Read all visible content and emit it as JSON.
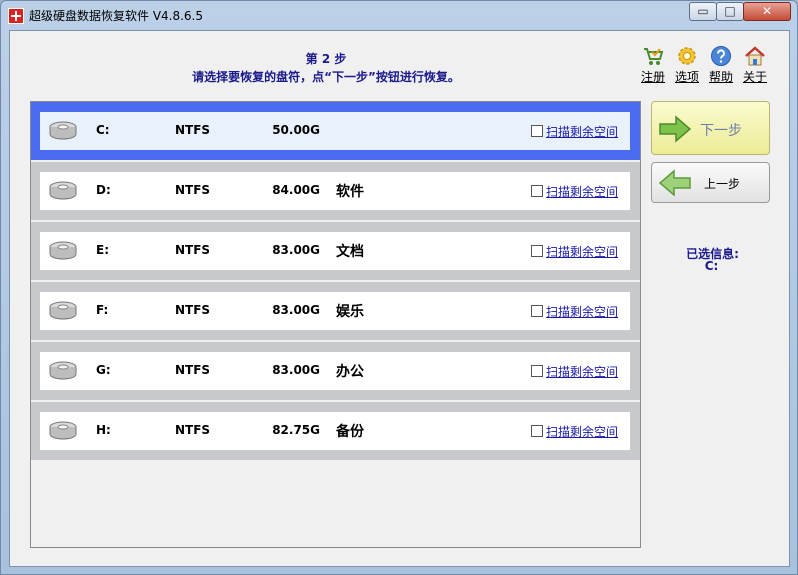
{
  "window": {
    "title": "超级硬盘数据恢复软件 V4.8.6.5",
    "minimize_symbol": "▭",
    "maximize_symbol": "□",
    "close_symbol": "✕"
  },
  "header": {
    "step": "第 2 步",
    "instruction": "请选择要恢复的盘符，点“下一步”按钮进行恢复。"
  },
  "toolbar": {
    "items": [
      {
        "label": "注册",
        "icon": "cart-icon"
      },
      {
        "label": "选项",
        "icon": "gear-icon"
      },
      {
        "label": "帮助",
        "icon": "help-icon"
      },
      {
        "label": "关于",
        "icon": "home-icon"
      }
    ]
  },
  "drives": [
    {
      "letter": "C:",
      "fs": "NTFS",
      "size": "50.00G",
      "label": "",
      "scan": "扫描剩余空间",
      "selected": true
    },
    {
      "letter": "D:",
      "fs": "NTFS",
      "size": "84.00G",
      "label": "软件",
      "scan": "扫描剩余空间",
      "selected": false
    },
    {
      "letter": "E:",
      "fs": "NTFS",
      "size": "83.00G",
      "label": "文档",
      "scan": "扫描剩余空间",
      "selected": false
    },
    {
      "letter": "F:",
      "fs": "NTFS",
      "size": "83.00G",
      "label": "娱乐",
      "scan": "扫描剩余空间",
      "selected": false
    },
    {
      "letter": "G:",
      "fs": "NTFS",
      "size": "83.00G",
      "label": "办公",
      "scan": "扫描剩余空间",
      "selected": false
    },
    {
      "letter": "H:",
      "fs": "NTFS",
      "size": "82.75G",
      "label": "备份",
      "scan": "扫描剩余空间",
      "selected": false
    }
  ],
  "buttons": {
    "next": "下一步",
    "prev": "上一步"
  },
  "selection": {
    "label": "已选信息:",
    "value": "C:"
  },
  "colors": {
    "selected_border": "#4a6cf0",
    "heading_text": "#1a1a8c",
    "link": "#1a1aa6",
    "next_button": "#ecec96"
  }
}
